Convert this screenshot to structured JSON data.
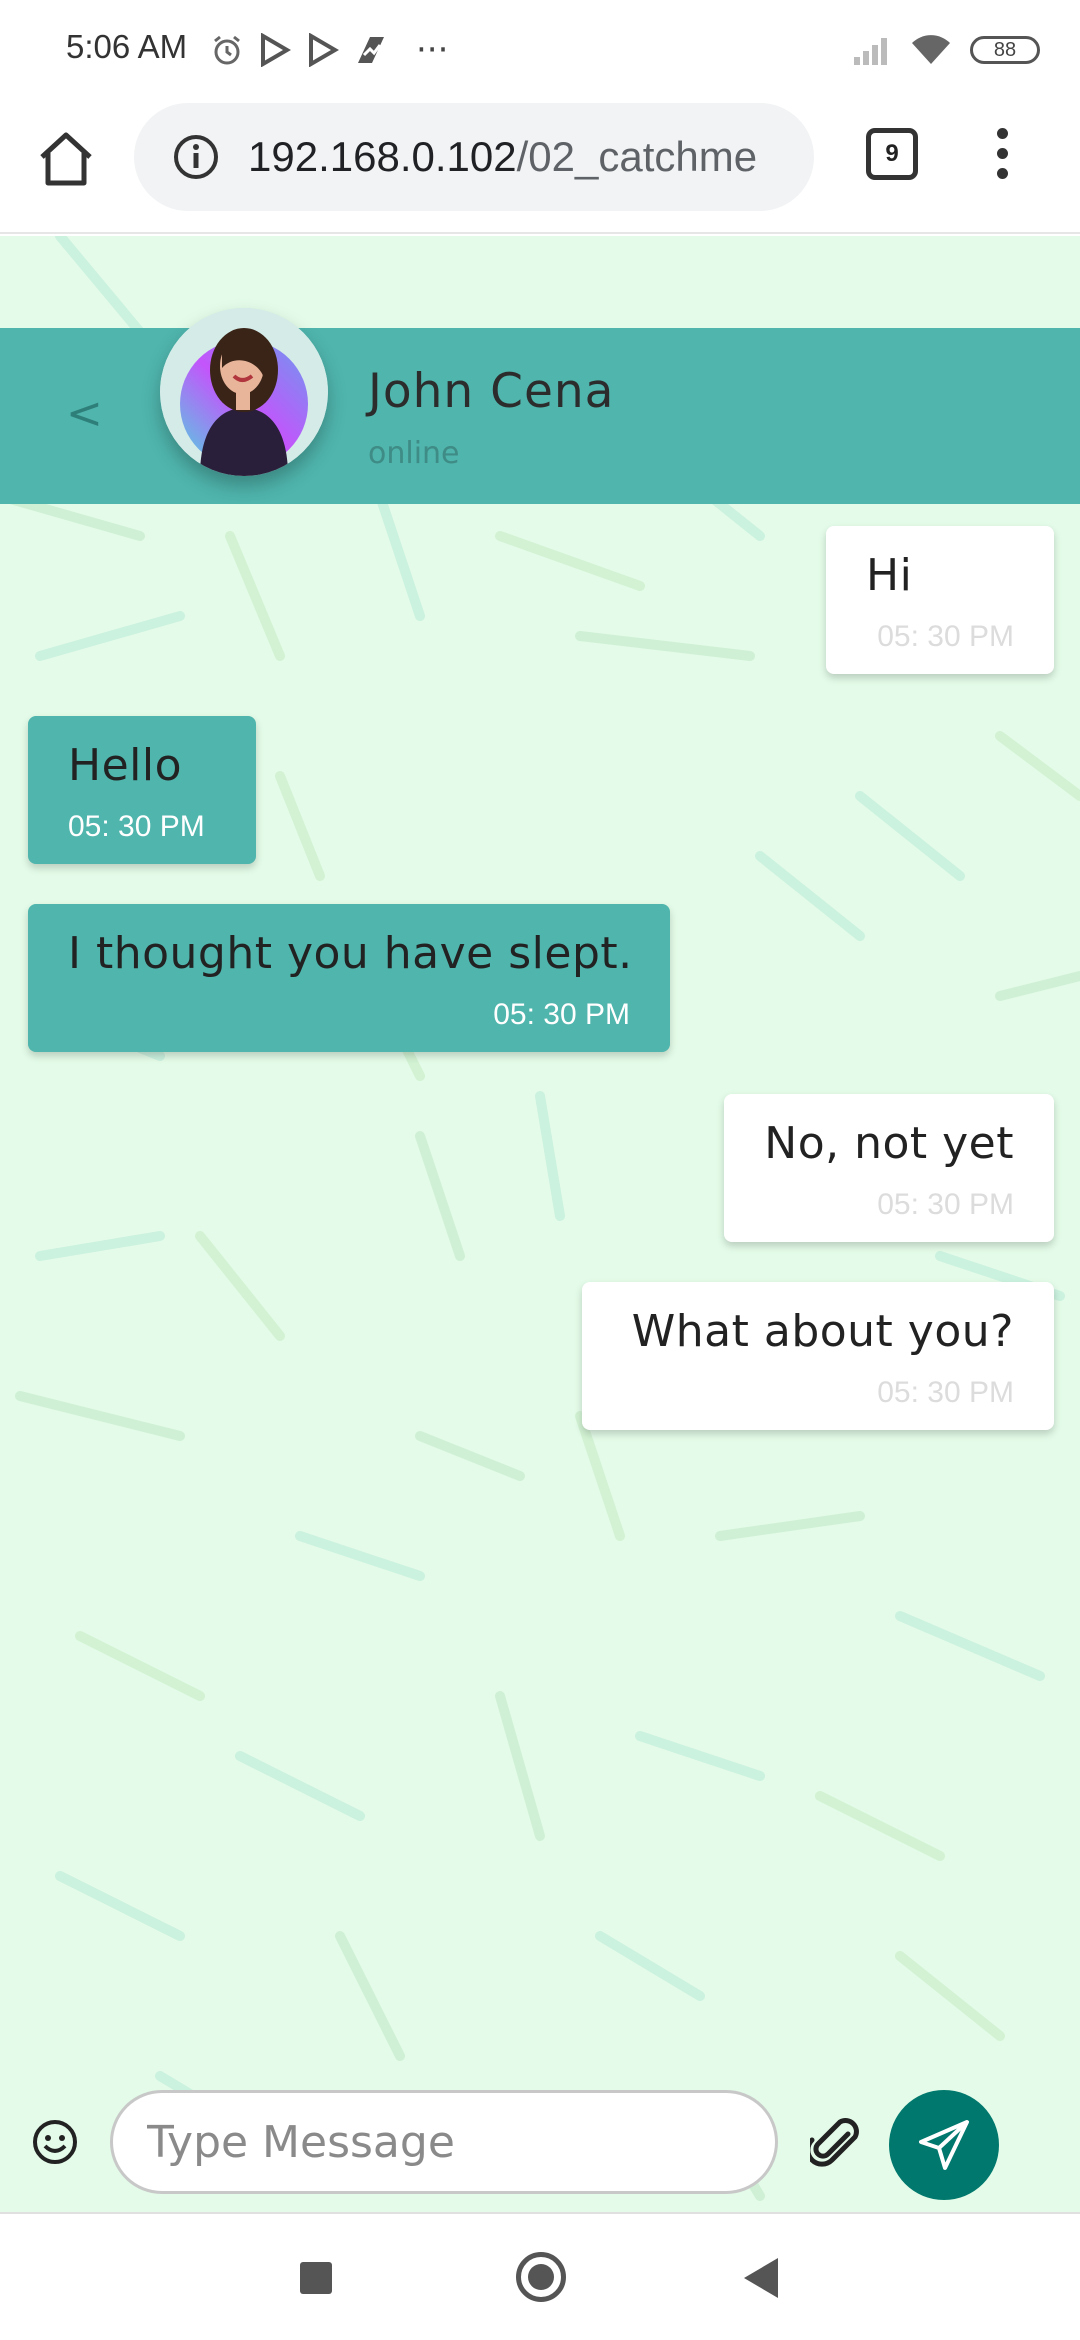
{
  "status_bar": {
    "time": "5:06 AM",
    "more": "···",
    "battery": "88",
    "icons_left": [
      "alarm-icon",
      "play-icon",
      "play-icon",
      "flow-icon"
    ],
    "icons_right": [
      "signal-icon",
      "wifi-icon",
      "battery-icon"
    ]
  },
  "browser": {
    "url_host": "192.168.0.102",
    "url_path": "/02_catchme",
    "tab_count": "9"
  },
  "chat": {
    "back_label": "<",
    "contact_name": "John Cena",
    "contact_status": "online",
    "messages": [
      {
        "direction": "out",
        "text": "Hi",
        "time": "05: 30 PM"
      },
      {
        "direction": "in",
        "text": "Hello",
        "time": "05: 30 PM"
      },
      {
        "direction": "in",
        "text": "I thought you have slept.",
        "time": "05: 30 PM"
      },
      {
        "direction": "out",
        "text": "No, not yet",
        "time": "05: 30 PM"
      },
      {
        "direction": "out",
        "text": "What about you?",
        "time": "05: 30 PM"
      }
    ]
  },
  "composer": {
    "placeholder": "Type Message"
  },
  "colors": {
    "accent": "#4fb5ad",
    "page_bg": "#e3fbe8",
    "send_button": "#00786d"
  }
}
